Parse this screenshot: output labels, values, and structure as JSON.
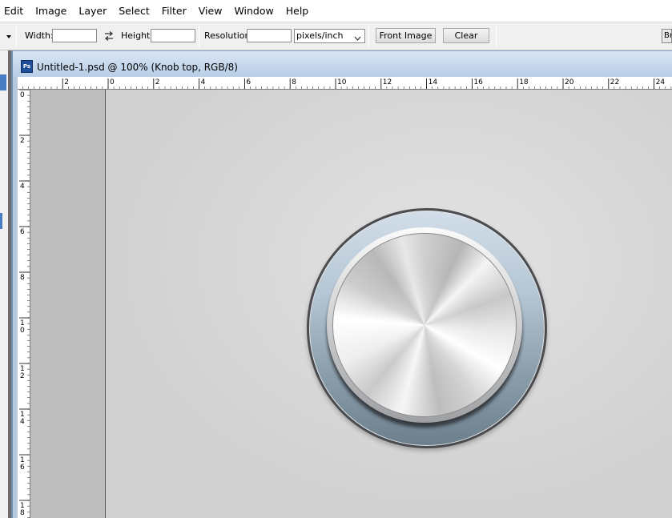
{
  "menu": [
    "Edit",
    "Image",
    "Layer",
    "Select",
    "Filter",
    "View",
    "Window",
    "Help"
  ],
  "options": {
    "width_label": "Width:",
    "width_value": "",
    "height_label": "Height:",
    "height_value": "",
    "resolution_label": "Resolution:",
    "resolution_value": "",
    "resolution_unit": "pixels/inch",
    "front_image_label": "Front Image",
    "clear_label": "Clear",
    "bridge_label": "Br"
  },
  "document": {
    "icon_label": "Ps",
    "title": "Untitled-1.psd @ 100% (Knob top, RGB/8)"
  },
  "rulers": {
    "horizontal_labels": [
      "2",
      "0",
      "2",
      "4",
      "6",
      "8",
      "10",
      "12",
      "14",
      "16",
      "18",
      "20",
      "22",
      "24"
    ],
    "vertical_labels": [
      "0",
      "2",
      "4",
      "6",
      "8",
      "10",
      "12",
      "14",
      "16",
      "18"
    ]
  },
  "icons": {
    "dropdown": "chevron-down-icon",
    "swap": "swap-arrows-icon",
    "document": "photoshop-doc-icon"
  },
  "colors": {
    "canvas_bg": "#d9d9d9",
    "pasteboard": "#bdbdbd",
    "titlebar": "#c9d9ec",
    "knob_ring": "#9fb2c1"
  }
}
